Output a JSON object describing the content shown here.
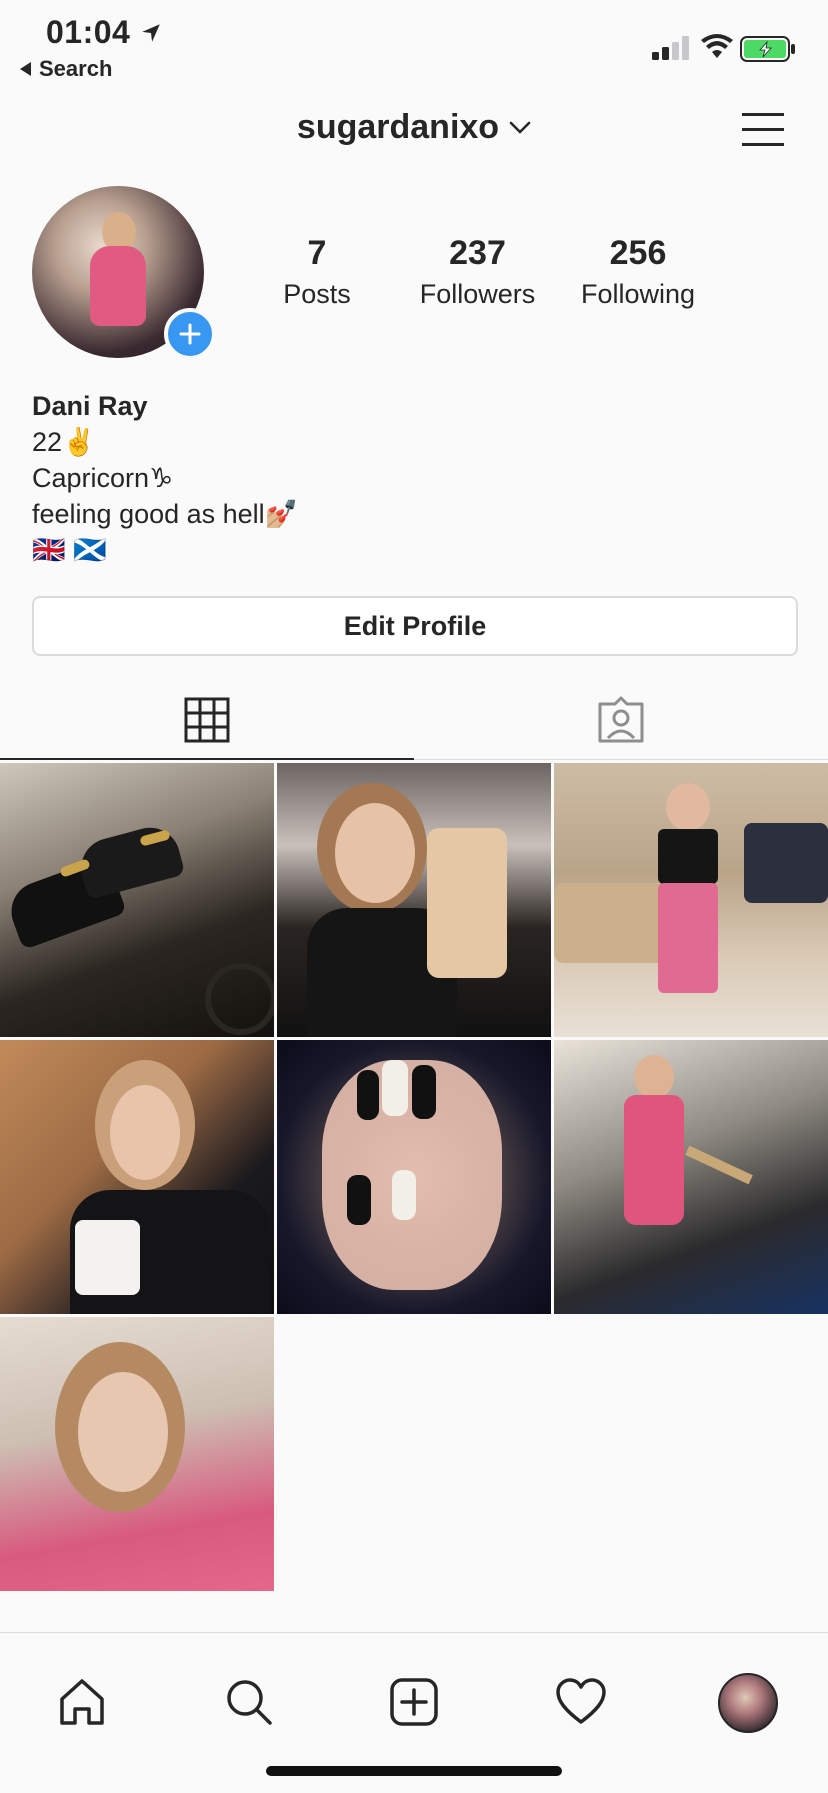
{
  "status_bar": {
    "time": "01:04",
    "back_label": "Search"
  },
  "header": {
    "username": "sugardanixo"
  },
  "stats": {
    "posts_count": "7",
    "posts_label": "Posts",
    "followers_count": "237",
    "followers_label": "Followers",
    "following_count": "256",
    "following_label": "Following"
  },
  "bio": {
    "name": "Dani Ray",
    "line1": "22✌️",
    "line2": "Capricorn♑",
    "line3": "feeling good as hell💅🏼",
    "line4": "🇬🇧 🏴󠁧󠁢󠁳󠁣󠁴󠁿"
  },
  "profile": {
    "edit_label": "Edit Profile"
  },
  "tabs": [
    {
      "icon": "grid-icon",
      "active": true
    },
    {
      "icon": "tagged-person-icon",
      "active": false
    }
  ],
  "posts": [
    {
      "subject": "shoes"
    },
    {
      "subject": "mirror selfie"
    },
    {
      "subject": "outfit in lounge"
    },
    {
      "subject": "cafe portrait"
    },
    {
      "subject": "nails"
    },
    {
      "subject": "pink dress"
    },
    {
      "subject": "pink sweater selfie"
    }
  ],
  "nav": {
    "home_icon": "home-icon",
    "search_icon": "search-icon",
    "add_icon": "add-post-icon",
    "activity_icon": "heart-icon",
    "profile_icon": "profile-avatar"
  },
  "colors": {
    "accent_blue": "#3897f0",
    "text": "#262626",
    "border": "#dbdbdb",
    "battery_green": "#4cd964"
  }
}
